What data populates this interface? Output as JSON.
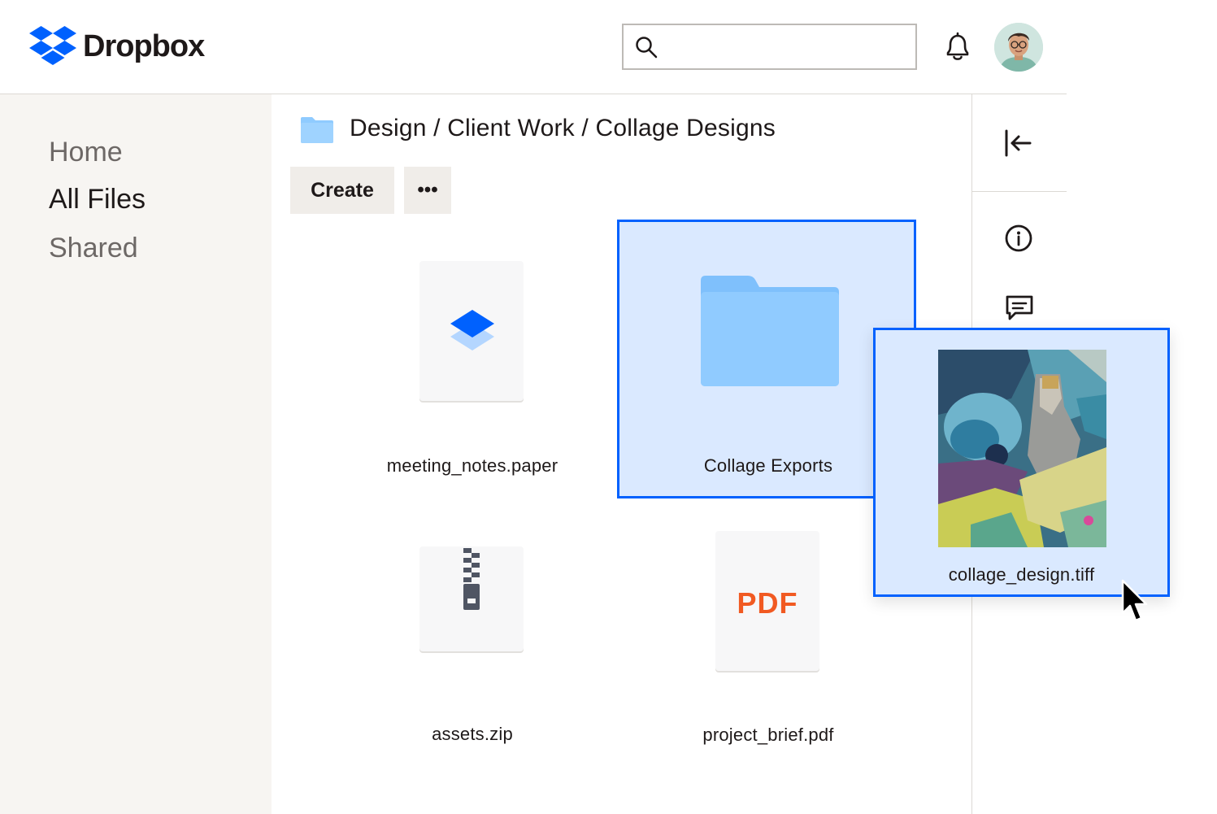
{
  "app": {
    "brand_name": "Dropbox",
    "brand_color": "#0061fe"
  },
  "header": {
    "search": {
      "placeholder": "",
      "value": "",
      "icon": "search-icon"
    },
    "notifications_icon": "bell-icon",
    "avatar": "user-avatar"
  },
  "sidebar": {
    "items": [
      {
        "label": "Home",
        "active": false
      },
      {
        "label": "All Files",
        "active": true
      },
      {
        "label": "Shared",
        "active": false
      }
    ]
  },
  "breadcrumb": {
    "path": "Design / Client Work / Collage Designs",
    "icon": "folder-icon"
  },
  "toolbar": {
    "create_label": "Create",
    "more_label": "•••"
  },
  "right_rail": {
    "icons": [
      "collapse-left-icon",
      "info-icon",
      "comment-icon"
    ]
  },
  "files": [
    {
      "name": "meeting_notes.paper",
      "type": "paper",
      "selected": false
    },
    {
      "name": "Collage Exports",
      "type": "folder",
      "selected": true
    },
    {
      "name": "assets.zip",
      "type": "zip",
      "selected": false
    },
    {
      "name": "project_brief.pdf",
      "type": "pdf",
      "badge": "PDF",
      "selected": false
    }
  ],
  "dragging": {
    "name": "collage_design.tiff",
    "type": "image"
  },
  "colors": {
    "selection_fill": "#dae9ff",
    "selection_border": "#0061fe",
    "folder": "#8fcbff",
    "pdf": "#f15a22",
    "sidebar_bg": "#f7f5f2"
  }
}
